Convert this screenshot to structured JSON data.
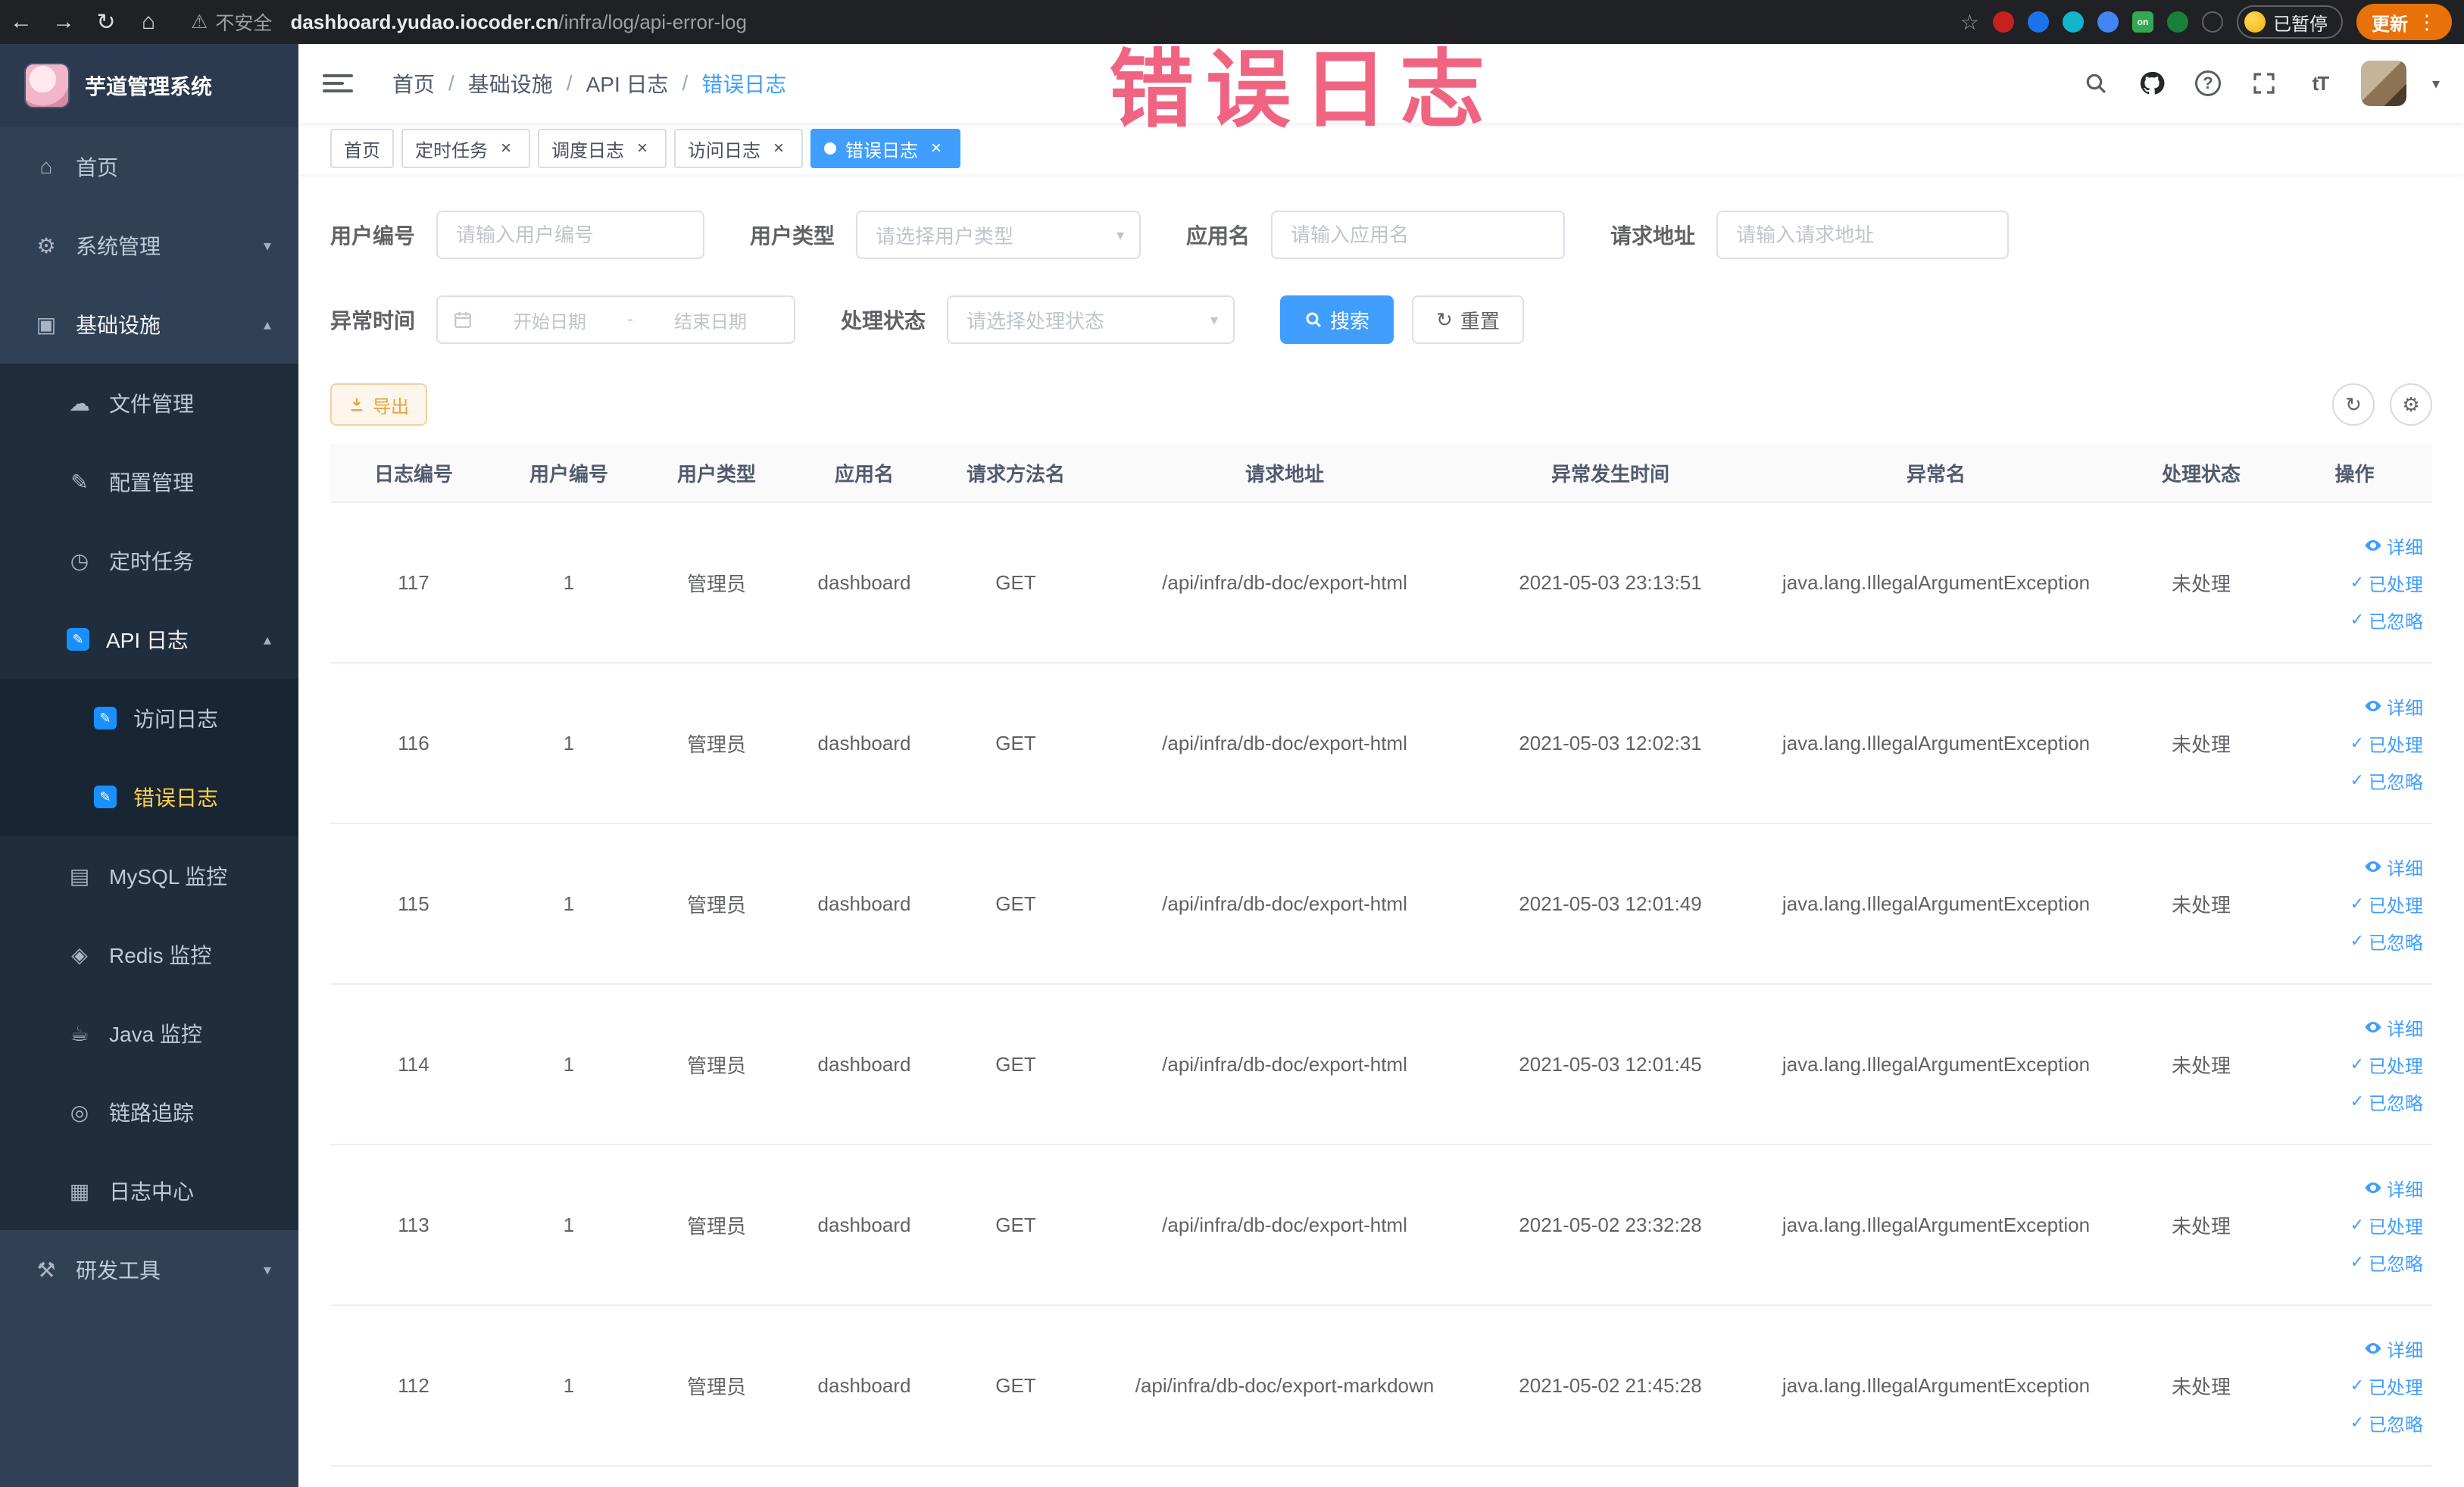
{
  "browser": {
    "security_label": "不安全",
    "url_host": "dashboard.yudao.iocoder.cn",
    "url_path": "/infra/log/api-error-log",
    "paused_badge": "已暂停",
    "update_label": "更新"
  },
  "watermark": "错误日志",
  "icons": {
    "back": "←",
    "forward": "→",
    "reload": "↻",
    "home_nav": "⌂",
    "warning": "⚠",
    "star": "☆",
    "more": "⋮",
    "menu_home": "⌂",
    "menu_system": "⚙",
    "menu_infra": "▣",
    "menu_file": "☁",
    "menu_config": "✎",
    "menu_job": "◷",
    "menu_pencil": "✎",
    "menu_mysql": "▤",
    "menu_redis": "◈",
    "menu_java": "☕",
    "menu_trace": "◎",
    "menu_logcenter": "▦",
    "menu_devtool": "⚒",
    "chevron_down": "▾",
    "chevron_up": "▴",
    "caret_down": "▾",
    "select_caret": "▾",
    "check": "✓",
    "close": "×",
    "refresh": "↻",
    "gear": "⚙",
    "question": "?",
    "font_size": "tT",
    "ext_on": "on"
  },
  "sidebar": {
    "logo_title": "芋道管理系统",
    "items": [
      {
        "label": "首页"
      },
      {
        "label": "系统管理"
      },
      {
        "label": "基础设施"
      },
      {
        "label": "文件管理"
      },
      {
        "label": "配置管理"
      },
      {
        "label": "定时任务"
      },
      {
        "label": "API 日志"
      },
      {
        "label": "访问日志"
      },
      {
        "label": "错误日志"
      },
      {
        "label": "MySQL 监控"
      },
      {
        "label": "Redis 监控"
      },
      {
        "label": "Java 监控"
      },
      {
        "label": "链路追踪"
      },
      {
        "label": "日志中心"
      },
      {
        "label": "研发工具"
      }
    ]
  },
  "breadcrumb": [
    "首页",
    "基础设施",
    "API 日志",
    "错误日志"
  ],
  "tabs": [
    {
      "label": "首页"
    },
    {
      "label": "定时任务"
    },
    {
      "label": "调度日志"
    },
    {
      "label": "访问日志"
    },
    {
      "label": "错误日志"
    }
  ],
  "filters": {
    "user_id_label": "用户编号",
    "user_id_placeholder": "请输入用户编号",
    "user_type_label": "用户类型",
    "user_type_placeholder": "请选择用户类型",
    "app_name_label": "应用名",
    "app_name_placeholder": "请输入应用名",
    "request_url_label": "请求地址",
    "request_url_placeholder": "请输入请求地址",
    "exception_time_label": "异常时间",
    "date_start_placeholder": "开始日期",
    "date_separator": "-",
    "date_end_placeholder": "结束日期",
    "status_label": "处理状态",
    "status_placeholder": "请选择处理状态",
    "search_label": "搜索",
    "reset_label": "重置"
  },
  "toolbar": {
    "export_label": "导出"
  },
  "table": {
    "columns": [
      "日志编号",
      "用户编号",
      "用户类型",
      "应用名",
      "请求方法名",
      "请求地址",
      "异常发生时间",
      "异常名",
      "处理状态",
      "操作"
    ],
    "actions": {
      "detail": "详细",
      "processed": "已处理",
      "ignored": "已忽略"
    },
    "rows": [
      {
        "log_id": "117",
        "user_id": "1",
        "user_type": "管理员",
        "app_name": "dashboard",
        "method": "GET",
        "url": "/api/infra/db-doc/export-html",
        "time": "2021-05-03 23:13:51",
        "exception": "java.lang.IllegalArgumentException",
        "status": "未处理"
      },
      {
        "log_id": "116",
        "user_id": "1",
        "user_type": "管理员",
        "app_name": "dashboard",
        "method": "GET",
        "url": "/api/infra/db-doc/export-html",
        "time": "2021-05-03 12:02:31",
        "exception": "java.lang.IllegalArgumentException",
        "status": "未处理"
      },
      {
        "log_id": "115",
        "user_id": "1",
        "user_type": "管理员",
        "app_name": "dashboard",
        "method": "GET",
        "url": "/api/infra/db-doc/export-html",
        "time": "2021-05-03 12:01:49",
        "exception": "java.lang.IllegalArgumentException",
        "status": "未处理"
      },
      {
        "log_id": "114",
        "user_id": "1",
        "user_type": "管理员",
        "app_name": "dashboard",
        "method": "GET",
        "url": "/api/infra/db-doc/export-html",
        "time": "2021-05-03 12:01:45",
        "exception": "java.lang.IllegalArgumentException",
        "status": "未处理"
      },
      {
        "log_id": "113",
        "user_id": "1",
        "user_type": "管理员",
        "app_name": "dashboard",
        "method": "GET",
        "url": "/api/infra/db-doc/export-html",
        "time": "2021-05-02 23:32:28",
        "exception": "java.lang.IllegalArgumentException",
        "status": "未处理"
      },
      {
        "log_id": "112",
        "user_id": "1",
        "user_type": "管理员",
        "app_name": "dashboard",
        "method": "GET",
        "url": "/api/infra/db-doc/export-markdown",
        "time": "2021-05-02 21:45:28",
        "exception": "java.lang.IllegalArgumentException",
        "status": "未处理"
      }
    ]
  }
}
